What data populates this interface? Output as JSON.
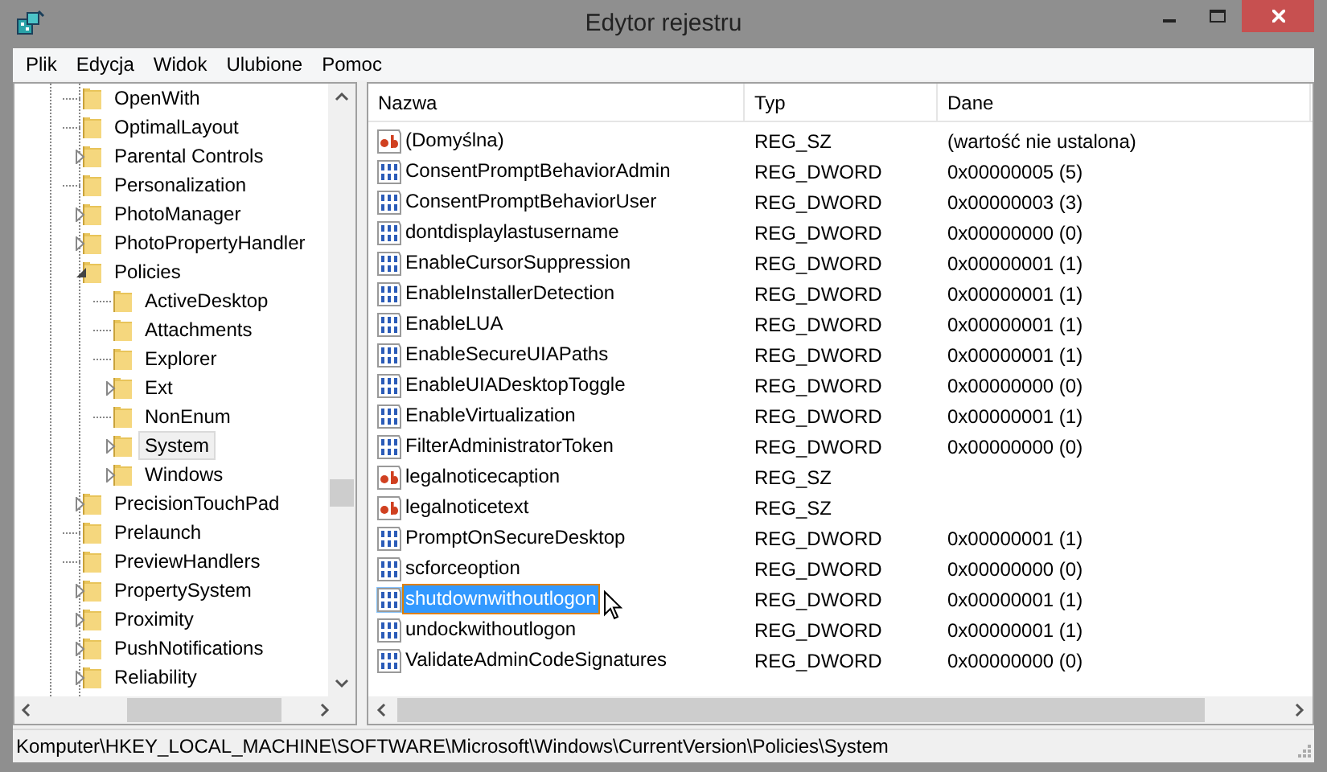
{
  "window": {
    "title": "Edytor rejestru"
  },
  "menu": [
    "Plik",
    "Edycja",
    "Widok",
    "Ulubione",
    "Pomoc"
  ],
  "tree": [
    {
      "label": "OpenWith",
      "expandable": false,
      "expanded": false,
      "selected": false
    },
    {
      "label": "OptimalLayout",
      "expandable": false,
      "expanded": false,
      "selected": false
    },
    {
      "label": "Parental Controls",
      "expandable": true,
      "expanded": false,
      "selected": false
    },
    {
      "label": "Personalization",
      "expandable": false,
      "expanded": false,
      "selected": false
    },
    {
      "label": "PhotoManager",
      "expandable": true,
      "expanded": false,
      "selected": false
    },
    {
      "label": "PhotoPropertyHandler",
      "expandable": true,
      "expanded": false,
      "selected": false
    },
    {
      "label": "Policies",
      "expandable": true,
      "expanded": true,
      "selected": false,
      "children": [
        {
          "label": "ActiveDesktop",
          "expandable": false,
          "expanded": false,
          "selected": false
        },
        {
          "label": "Attachments",
          "expandable": false,
          "expanded": false,
          "selected": false
        },
        {
          "label": "Explorer",
          "expandable": false,
          "expanded": false,
          "selected": false
        },
        {
          "label": "Ext",
          "expandable": true,
          "expanded": false,
          "selected": false
        },
        {
          "label": "NonEnum",
          "expandable": false,
          "expanded": false,
          "selected": false
        },
        {
          "label": "System",
          "expandable": true,
          "expanded": false,
          "selected": true
        },
        {
          "label": "Windows",
          "expandable": true,
          "expanded": false,
          "selected": false
        }
      ]
    },
    {
      "label": "PrecisionTouchPad",
      "expandable": true,
      "expanded": false,
      "selected": false
    },
    {
      "label": "Prelaunch",
      "expandable": false,
      "expanded": false,
      "selected": false
    },
    {
      "label": "PreviewHandlers",
      "expandable": false,
      "expanded": false,
      "selected": false
    },
    {
      "label": "PropertySystem",
      "expandable": true,
      "expanded": false,
      "selected": false
    },
    {
      "label": "Proximity",
      "expandable": true,
      "expanded": false,
      "selected": false
    },
    {
      "label": "PushNotifications",
      "expandable": true,
      "expanded": false,
      "selected": false
    },
    {
      "label": "Reliability",
      "expandable": true,
      "expanded": false,
      "selected": false
    }
  ],
  "table": {
    "columns": [
      "Nazwa",
      "Typ",
      "Dane"
    ],
    "rows": [
      {
        "kind": "string",
        "name": "(Domyślna)",
        "type": "REG_SZ",
        "data": "(wartość nie ustalona)",
        "selected": false
      },
      {
        "kind": "dword",
        "name": "ConsentPromptBehaviorAdmin",
        "type": "REG_DWORD",
        "data": "0x00000005 (5)",
        "selected": false
      },
      {
        "kind": "dword",
        "name": "ConsentPromptBehaviorUser",
        "type": "REG_DWORD",
        "data": "0x00000003 (3)",
        "selected": false
      },
      {
        "kind": "dword",
        "name": "dontdisplaylastusername",
        "type": "REG_DWORD",
        "data": "0x00000000 (0)",
        "selected": false
      },
      {
        "kind": "dword",
        "name": "EnableCursorSuppression",
        "type": "REG_DWORD",
        "data": "0x00000001 (1)",
        "selected": false
      },
      {
        "kind": "dword",
        "name": "EnableInstallerDetection",
        "type": "REG_DWORD",
        "data": "0x00000001 (1)",
        "selected": false
      },
      {
        "kind": "dword",
        "name": "EnableLUA",
        "type": "REG_DWORD",
        "data": "0x00000001 (1)",
        "selected": false
      },
      {
        "kind": "dword",
        "name": "EnableSecureUIAPaths",
        "type": "REG_DWORD",
        "data": "0x00000001 (1)",
        "selected": false
      },
      {
        "kind": "dword",
        "name": "EnableUIADesktopToggle",
        "type": "REG_DWORD",
        "data": "0x00000000 (0)",
        "selected": false
      },
      {
        "kind": "dword",
        "name": "EnableVirtualization",
        "type": "REG_DWORD",
        "data": "0x00000001 (1)",
        "selected": false
      },
      {
        "kind": "dword",
        "name": "FilterAdministratorToken",
        "type": "REG_DWORD",
        "data": "0x00000000 (0)",
        "selected": false
      },
      {
        "kind": "string",
        "name": "legalnoticecaption",
        "type": "REG_SZ",
        "selected": false
      },
      {
        "kind": "string",
        "name": "legalnoticetext",
        "type": "REG_SZ",
        "selected": false
      },
      {
        "kind": "dword",
        "name": "PromptOnSecureDesktop",
        "type": "REG_DWORD",
        "data": "0x00000001 (1)",
        "selected": false
      },
      {
        "kind": "dword",
        "name": "scforceoption",
        "type": "REG_DWORD",
        "data": "0x00000000 (0)",
        "selected": false
      },
      {
        "kind": "dword",
        "name": "shutdownwithoutlogon",
        "type": "REG_DWORD",
        "data": "0x00000001 (1)",
        "selected": true
      },
      {
        "kind": "dword",
        "name": "undockwithoutlogon",
        "type": "REG_DWORD",
        "data": "0x00000001 (1)",
        "selected": false
      },
      {
        "kind": "dword",
        "name": "ValidateAdminCodeSignatures",
        "type": "REG_DWORD",
        "data": "0x00000000 (0)",
        "selected": false
      }
    ]
  },
  "status_bar": "Komputer\\HKEY_LOCAL_MACHINE\\SOFTWARE\\Microsoft\\Windows\\CurrentVersion\\Policies\\System"
}
